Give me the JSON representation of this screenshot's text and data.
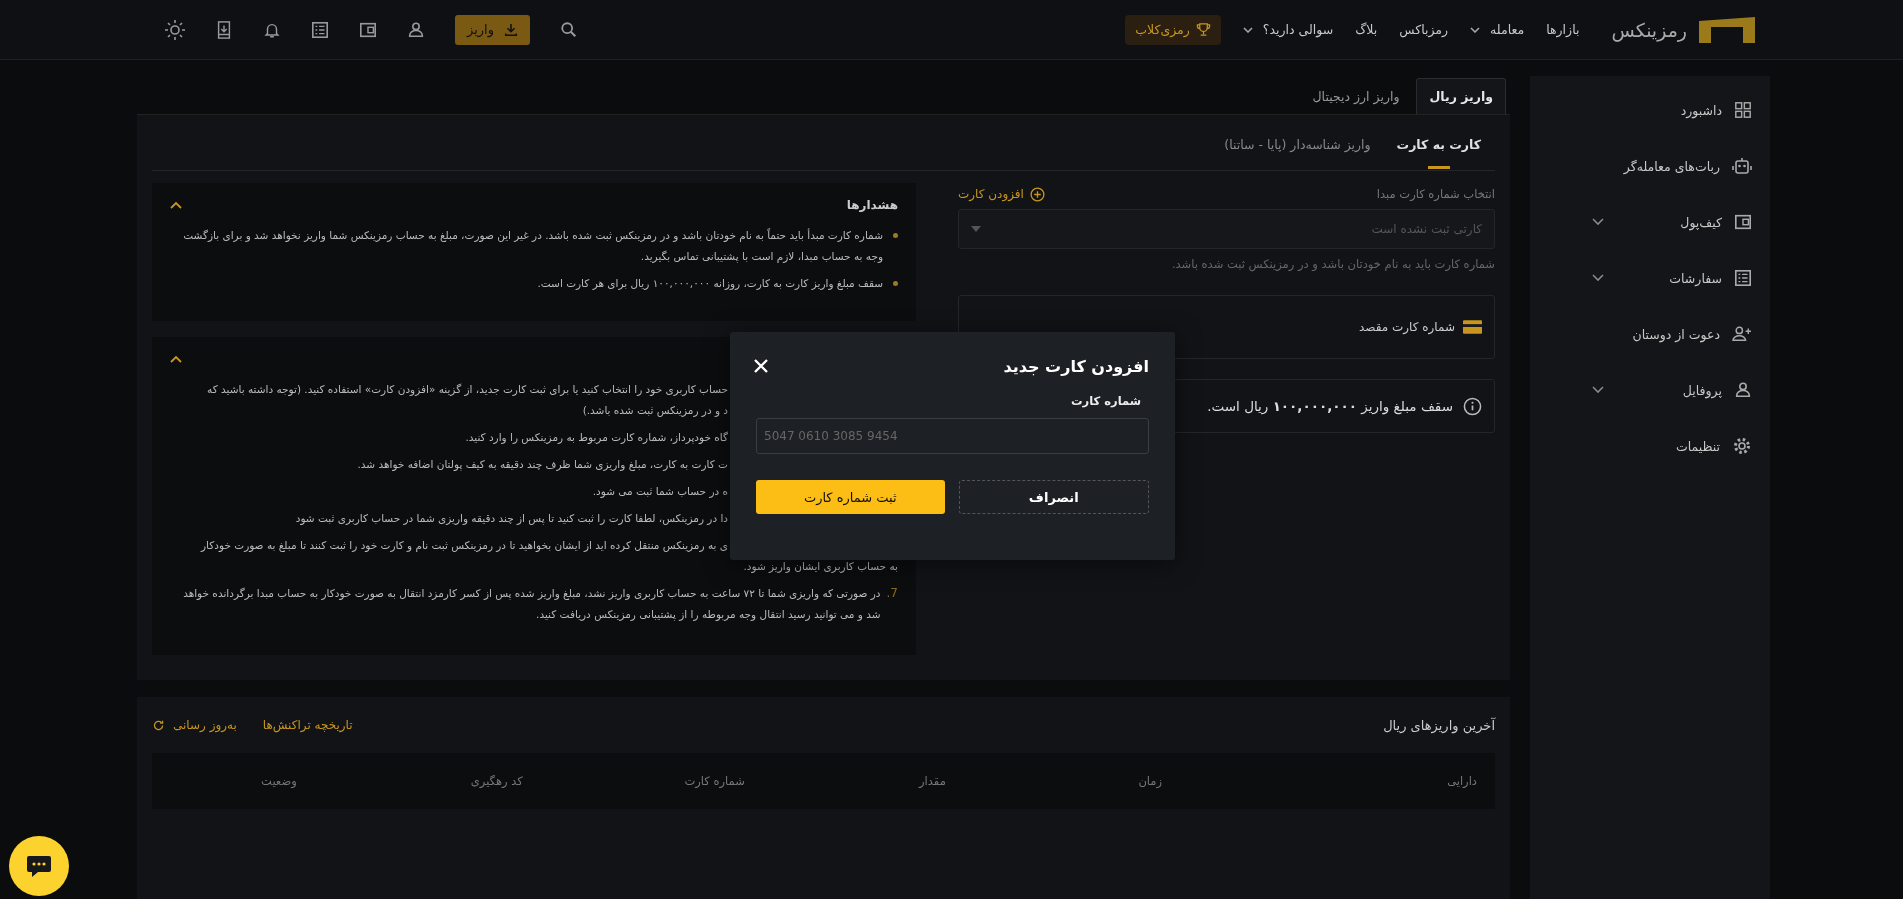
{
  "header": {
    "logo_text": "رمزینکس",
    "nav": [
      {
        "label": "بازارها",
        "dropdown": false
      },
      {
        "label": "معامله",
        "dropdown": true
      },
      {
        "label": "رمزباکس",
        "dropdown": false
      },
      {
        "label": "بلاگ",
        "dropdown": false
      },
      {
        "label": "سوالی دارید؟",
        "dropdown": true
      }
    ],
    "club_button": "رمزی‌کلاب",
    "deposit_button": "واریز"
  },
  "sidebar": {
    "items": [
      {
        "label": "داشبورد",
        "kind": "link"
      },
      {
        "label": "ربات‌های معامله‌گر",
        "kind": "link"
      },
      {
        "label": "کیف‌پول",
        "kind": "group"
      },
      {
        "label": "سفارشات",
        "kind": "group"
      },
      {
        "label": "دعوت از دوستان",
        "kind": "link"
      },
      {
        "label": "پروفایل",
        "kind": "group"
      },
      {
        "label": "تنظیمات",
        "kind": "link"
      }
    ]
  },
  "tabs": [
    {
      "label": "واریز ریال",
      "selected": true
    },
    {
      "label": "واریز ارز دیجیتال",
      "selected": false
    }
  ],
  "subtabs": [
    {
      "label": "کارت به کارت",
      "selected": true
    },
    {
      "label": "واریز شناسه‌دار (پایا - ساتنا)",
      "selected": false
    }
  ],
  "source_card": {
    "label": "انتخاب شماره کارت مبدا",
    "add_link": "افزودن کارت",
    "placeholder": "کارتی ثبت نشده است",
    "hint": "شماره کارت باید به نام خودتان باشد و در رمزینکس ثبت شده باشد."
  },
  "destination_card": {
    "label": "شماره کارت مقصد"
  },
  "limit_notice": "سقف مبلغ واریز **۱۰۰,۰۰۰,۰۰۰** ریال است.",
  "warnings": {
    "title": "هشدارها",
    "expanded": true,
    "items": [
      "شماره کارت مبدأ باید حتماً به نام خودتان باشد و در رمزینکس ثبت شده باشد. در غیر این صورت، مبلغ به حساب رمزینکس شما واریز نخواهد شد و برای بازگشت وجه به حساب مبدا، لازم است با پشتیبانی تماس بگیرید.",
      "سقف مبلغ واریز کارت به کارت، روزانه ۱۰۰,۰۰۰,۰۰۰ ریال برای هر کارت است."
    ]
  },
  "instructions": {
    "expanded": true,
    "items": [
      {
        "lines": [
          {
            "kind": "cut",
            "text": "حساب کاربری خود را انتخاب کنید یا برای ثبت کارت جدید، از گزینه «افزودن کارت» استفاده کنید. (توجه داشته باشید که"
          },
          {
            "kind": "cut",
            "text": "د و در رمزینکس ثبت شده باشد.)"
          }
        ]
      },
      {
        "lines": [
          {
            "kind": "cut",
            "text": "گاه خودپرداز، شماره کارت مربوط به رمزینکس را وارد کنید."
          }
        ]
      },
      {
        "lines": [
          {
            "kind": "cut",
            "text": "ت کارت به کارت، مبلغ واریزی شما ظرف چند دقیقه به کیف پولتان اضافه خواهد شد."
          }
        ]
      },
      {
        "lines": [
          {
            "kind": "cut",
            "text": "ه در حساب شما ثبت می شود."
          }
        ]
      },
      {
        "lines": [
          {
            "kind": "cut",
            "text": "دا در رمزینکس، لطفا کارت را ثبت کنید تا پس از چند دقیقه واریزی شما در حساب کاربری ثبت شود"
          }
        ]
      },
      {
        "lines": [
          {
            "kind": "cut",
            "text": "ی به رمزینکس منتقل کرده اید از ایشان بخواهید تا در رمزینکس ثبت نام و کارت خود را ثبت کنند تا مبلغ به صورت خودکار"
          },
          {
            "kind": "full",
            "text": "به حساب کاربری ایشان واریز شود."
          }
        ]
      },
      {
        "number": "7.",
        "lines": [
          {
            "kind": "full",
            "text": "در صورتی که واریزی شما تا ۷۲ ساعت به حساب کاربری واریز نشد، مبلغ واریز شده پس از کسر کارمزد انتقال به صورت خودکار به حساب مبدا برگردانده خواهد شد و می توانید رسید انتقال وجه مربوطه را از پشتیبانی رمزینکس دریافت کنید."
          }
        ]
      }
    ]
  },
  "recent": {
    "title": "آخرین واریزهای ریال",
    "history_link": "تاریخچه تراکنش‌ها",
    "refresh_link": "به‌روز رسانی",
    "columns": [
      "دارایی",
      "زمان",
      "مقدار",
      "شماره کارت",
      "کد رهگیری",
      "وضعیت"
    ]
  },
  "modal": {
    "title": "افزودن کارت جدید",
    "field_label": "شماره کارت",
    "placeholder": "5047 0610 3085 9454",
    "submit": "ثبت شماره کارت",
    "cancel": "انصراف"
  }
}
